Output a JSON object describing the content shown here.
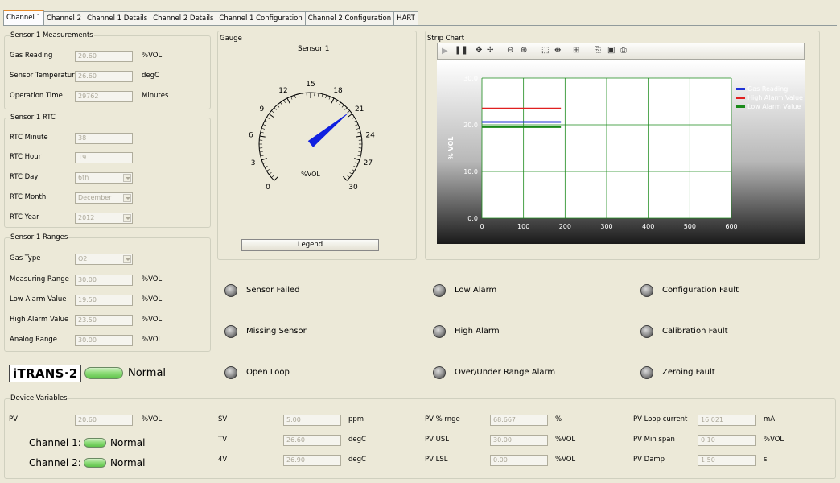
{
  "tabs": [
    "Channel 1",
    "Channel 2",
    "Channel 1 Details",
    "Channel 2 Details",
    "Channel 1 Configuration",
    "Channel 2 Configuration",
    "HART"
  ],
  "measurements": {
    "title": "Sensor 1 Measurements",
    "rows": [
      {
        "label": "Gas Reading",
        "value": "20.60",
        "unit": "%VOL"
      },
      {
        "label": "Sensor Temperature",
        "value": "26.60",
        "unit": "degC"
      },
      {
        "label": "Operation Time",
        "value": "29762",
        "unit": "Minutes"
      }
    ]
  },
  "rtc": {
    "title": "Sensor 1 RTC",
    "rows": [
      {
        "label": "RTC Minute",
        "value": "38"
      },
      {
        "label": "RTC Hour",
        "value": "19"
      },
      {
        "label": "RTC Day",
        "value": "6th"
      },
      {
        "label": "RTC Month",
        "value": "December"
      },
      {
        "label": "RTC Year",
        "value": "2012"
      }
    ]
  },
  "ranges": {
    "title": "Sensor 1 Ranges",
    "rows": [
      {
        "label": "Gas Type",
        "value": "O2",
        "unit": ""
      },
      {
        "label": "Measuring Range",
        "value": "30.00",
        "unit": "%VOL"
      },
      {
        "label": "Low Alarm Value",
        "value": "19.50",
        "unit": "%VOL"
      },
      {
        "label": "High Alarm Value",
        "value": "23.50",
        "unit": "%VOL"
      },
      {
        "label": "Analog Range",
        "value": "30.00",
        "unit": "%VOL"
      }
    ]
  },
  "brand": {
    "logo": "iTRANS·2",
    "status": "Normal"
  },
  "gauge": {
    "title": "Gauge",
    "sensor": "Sensor 1",
    "unit": "%VOL",
    "ticks": [
      "0",
      "3",
      "6",
      "9",
      "12",
      "15",
      "18",
      "21",
      "24",
      "27",
      "30"
    ],
    "min": 0,
    "max": 30,
    "value": 20.6,
    "legend_button": "Legend"
  },
  "strip": {
    "title": "Strip Chart"
  },
  "chart_data": {
    "type": "line",
    "ylabel": "% VOL",
    "xlim": [
      0,
      600
    ],
    "ylim": [
      0,
      30
    ],
    "xticks": [
      "0",
      "100",
      "200",
      "300",
      "400",
      "500",
      "600"
    ],
    "yticks": [
      "0.0",
      "10.0",
      "20.0",
      "30.0"
    ],
    "series": [
      {
        "name": "Gas Reading",
        "color": "#1f33d6",
        "x": [
          0,
          190
        ],
        "values": [
          20.6,
          20.6
        ]
      },
      {
        "name": "High Alarm Value",
        "color": "#e02020",
        "x": [
          0,
          190
        ],
        "values": [
          23.5,
          23.5
        ]
      },
      {
        "name": "Low Alarm Value",
        "color": "#1a8a1a",
        "x": [
          0,
          190
        ],
        "values": [
          19.5,
          19.5
        ]
      }
    ]
  },
  "status_lamps": [
    [
      "Sensor Failed",
      "Low Alarm",
      "Configuration Fault"
    ],
    [
      "Missing Sensor",
      "High Alarm",
      "Calibration Fault"
    ],
    [
      "Open Loop",
      "Over/Under Range Alarm",
      "Zeroing Fault"
    ]
  ],
  "device": {
    "title": "Device Variables",
    "pv": {
      "label": "PV",
      "value": "20.60",
      "unit": "%VOL"
    },
    "channels": [
      {
        "label": "Channel 1:",
        "status": "Normal"
      },
      {
        "label": "Channel 2:",
        "status": "Normal"
      }
    ],
    "col2": [
      {
        "label": "SV",
        "value": "5.00",
        "unit": "ppm"
      },
      {
        "label": "TV",
        "value": "26.60",
        "unit": "degC"
      },
      {
        "label": "4V",
        "value": "26.90",
        "unit": "degC"
      }
    ],
    "col3": [
      {
        "label": "PV % rnge",
        "value": "68.667",
        "unit": "%"
      },
      {
        "label": "PV USL",
        "value": "30.00",
        "unit": "%VOL"
      },
      {
        "label": "PV LSL",
        "value": "0.00",
        "unit": "%VOL"
      }
    ],
    "col4": [
      {
        "label": "PV Loop current",
        "value": "16.021",
        "unit": "mA"
      },
      {
        "label": "PV Min span",
        "value": "0.10",
        "unit": "%VOL"
      },
      {
        "label": "PV Damp",
        "value": "1.50",
        "unit": "s"
      }
    ]
  }
}
